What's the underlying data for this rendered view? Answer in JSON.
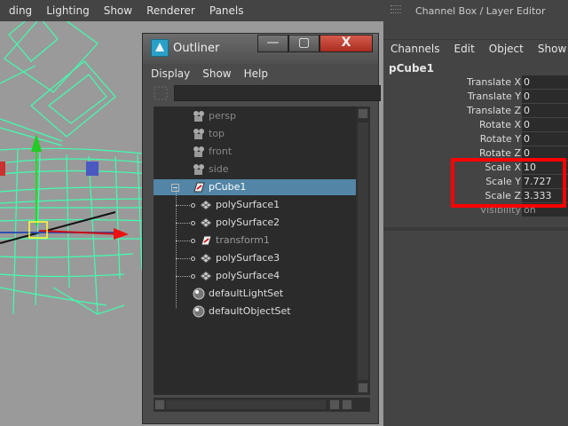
{
  "main_menu": [
    "ding",
    "Lighting",
    "Show",
    "Renderer",
    "Panels"
  ],
  "outliner": {
    "title": "Outliner",
    "buttons": {
      "minimize": "—",
      "maximize": "▢",
      "close": "X"
    },
    "menu": [
      "Display",
      "Show",
      "Help"
    ],
    "items": [
      {
        "label": "persp",
        "dim": true
      },
      {
        "label": "top",
        "dim": true
      },
      {
        "label": "front",
        "dim": true
      },
      {
        "label": "side",
        "dim": true
      },
      {
        "label": "pCube1",
        "selected": true
      },
      {
        "label": "polySurface1"
      },
      {
        "label": "polySurface2"
      },
      {
        "label": "transform1",
        "dim": true
      },
      {
        "label": "polySurface3"
      },
      {
        "label": "polySurface4"
      },
      {
        "label": "defaultLightSet"
      },
      {
        "label": "defaultObjectSet"
      }
    ]
  },
  "channel_box": {
    "title": "Channel Box / Layer Editor",
    "menu": [
      "Channels",
      "Edit",
      "Object",
      "Show"
    ],
    "node": "pCube1",
    "attributes": [
      {
        "label": "Translate X",
        "value": "0"
      },
      {
        "label": "Translate Y",
        "value": "0"
      },
      {
        "label": "Translate Z",
        "value": "0"
      },
      {
        "label": "Rotate X",
        "value": "0"
      },
      {
        "label": "Rotate Y",
        "value": "0"
      },
      {
        "label": "Rotate Z",
        "value": "0"
      },
      {
        "label": "Scale X",
        "value": "10"
      },
      {
        "label": "Scale Y",
        "value": "7.727"
      },
      {
        "label": "Scale Z",
        "value": "3.333"
      },
      {
        "label": "Visibility",
        "value": "on"
      }
    ]
  },
  "colors": {
    "highlight": "#ff0000",
    "selection": "#5285a6",
    "wireframe": "#3fffb0"
  }
}
